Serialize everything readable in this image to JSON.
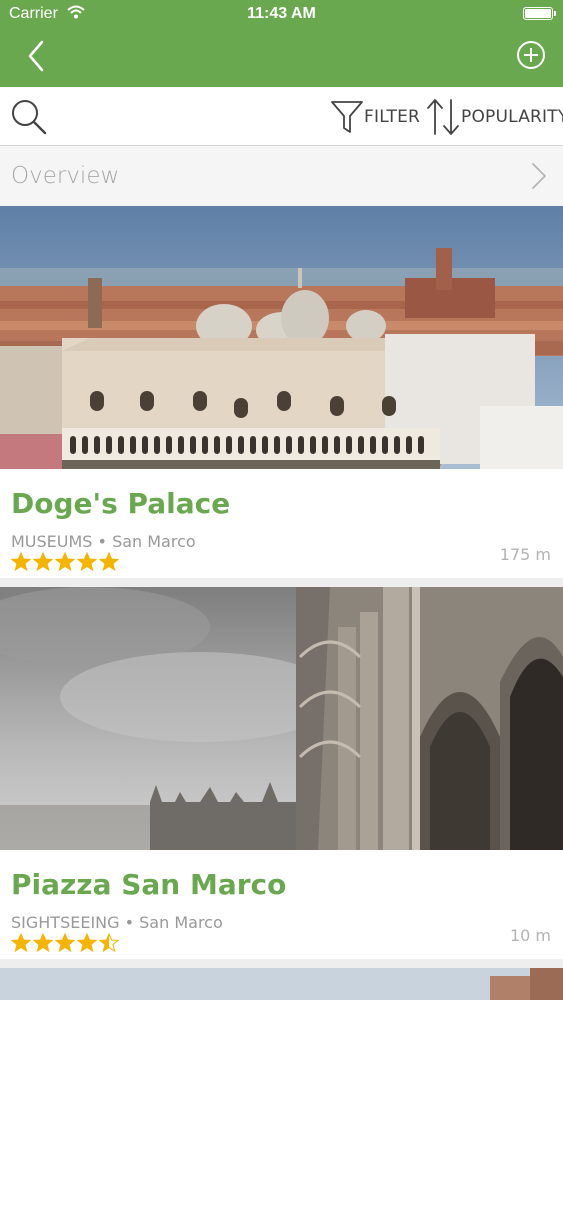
{
  "status_bar": {
    "carrier": "Carrier",
    "time": "11:43 AM",
    "battery_level": 1.0
  },
  "nav_bar": {
    "back_icon": "chevron-left-icon",
    "add_icon": "plus-circle-icon",
    "accent_color": "#6aa84f"
  },
  "toolbar": {
    "search_icon": "search-icon",
    "filter_label": "FILTER",
    "filter_icon": "funnel-icon",
    "sort_label": "POPULARITY",
    "sort_icon": "sort-arrows-icon"
  },
  "overview": {
    "label": "Overview"
  },
  "places": [
    {
      "title": "Doge's Palace",
      "category": "MUSEUMS",
      "area": "San Marco",
      "meta": "MUSEUMS • San Marco",
      "rating": 5,
      "distance": "175 m"
    },
    {
      "title": "Piazza San Marco",
      "category": "SIGHTSEEING",
      "area": "San Marco",
      "meta": "SIGHTSEEING • San Marco",
      "rating": 4.5,
      "distance": "10 m"
    }
  ],
  "star_color": "#f4b400"
}
